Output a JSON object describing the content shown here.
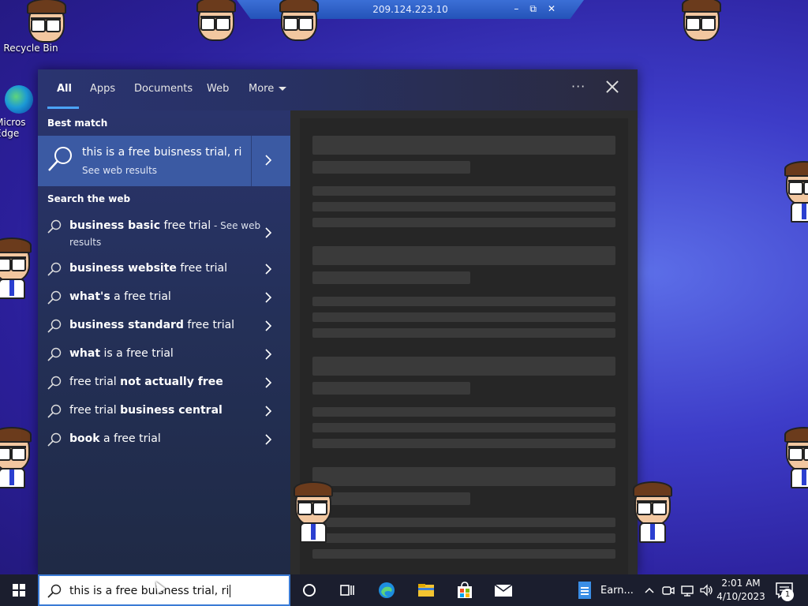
{
  "remote_bar": {
    "title": "209.124.223.10",
    "minimize": "–",
    "restore": "⧉",
    "close": "✕"
  },
  "desktop": {
    "icons": [
      {
        "label": "Recycle Bin"
      },
      {
        "label": "Micros Edge"
      }
    ]
  },
  "search_panel": {
    "tabs": [
      {
        "label": "All"
      },
      {
        "label": "Apps"
      },
      {
        "label": "Documents"
      },
      {
        "label": "Web"
      },
      {
        "label": "More"
      }
    ],
    "options_label": "···",
    "best_match_heading": "Best match",
    "best_match": {
      "title": "this is a free buisness trial, ri",
      "subtitle": "See web results"
    },
    "web_heading": "Search the web",
    "suggestions": [
      {
        "bold": "business basic",
        "rest": " free trial",
        "suffix": " - See web",
        "line2": "results"
      },
      {
        "bold": "business website",
        "rest": " free trial"
      },
      {
        "bold": "what's",
        "rest": " a free trial"
      },
      {
        "bold": "business standard",
        "rest": " free trial"
      },
      {
        "bold": "what",
        "rest": " is a free trial"
      },
      {
        "pre": "free trial ",
        "bold": "not actually free"
      },
      {
        "pre": "free trial ",
        "bold": "business central"
      },
      {
        "bold": "book",
        "rest": " a free trial"
      }
    ]
  },
  "taskbar": {
    "search_text": "this is a free buisness trial, ri",
    "pinned_app_label": "Earn...",
    "time": "2:01 AM",
    "date": "4/10/2023",
    "notification_count": "1"
  },
  "colors": {
    "accent": "#3b5aa3",
    "tab_underline": "#4ba3f6",
    "taskbar": "#1b1e2e"
  }
}
